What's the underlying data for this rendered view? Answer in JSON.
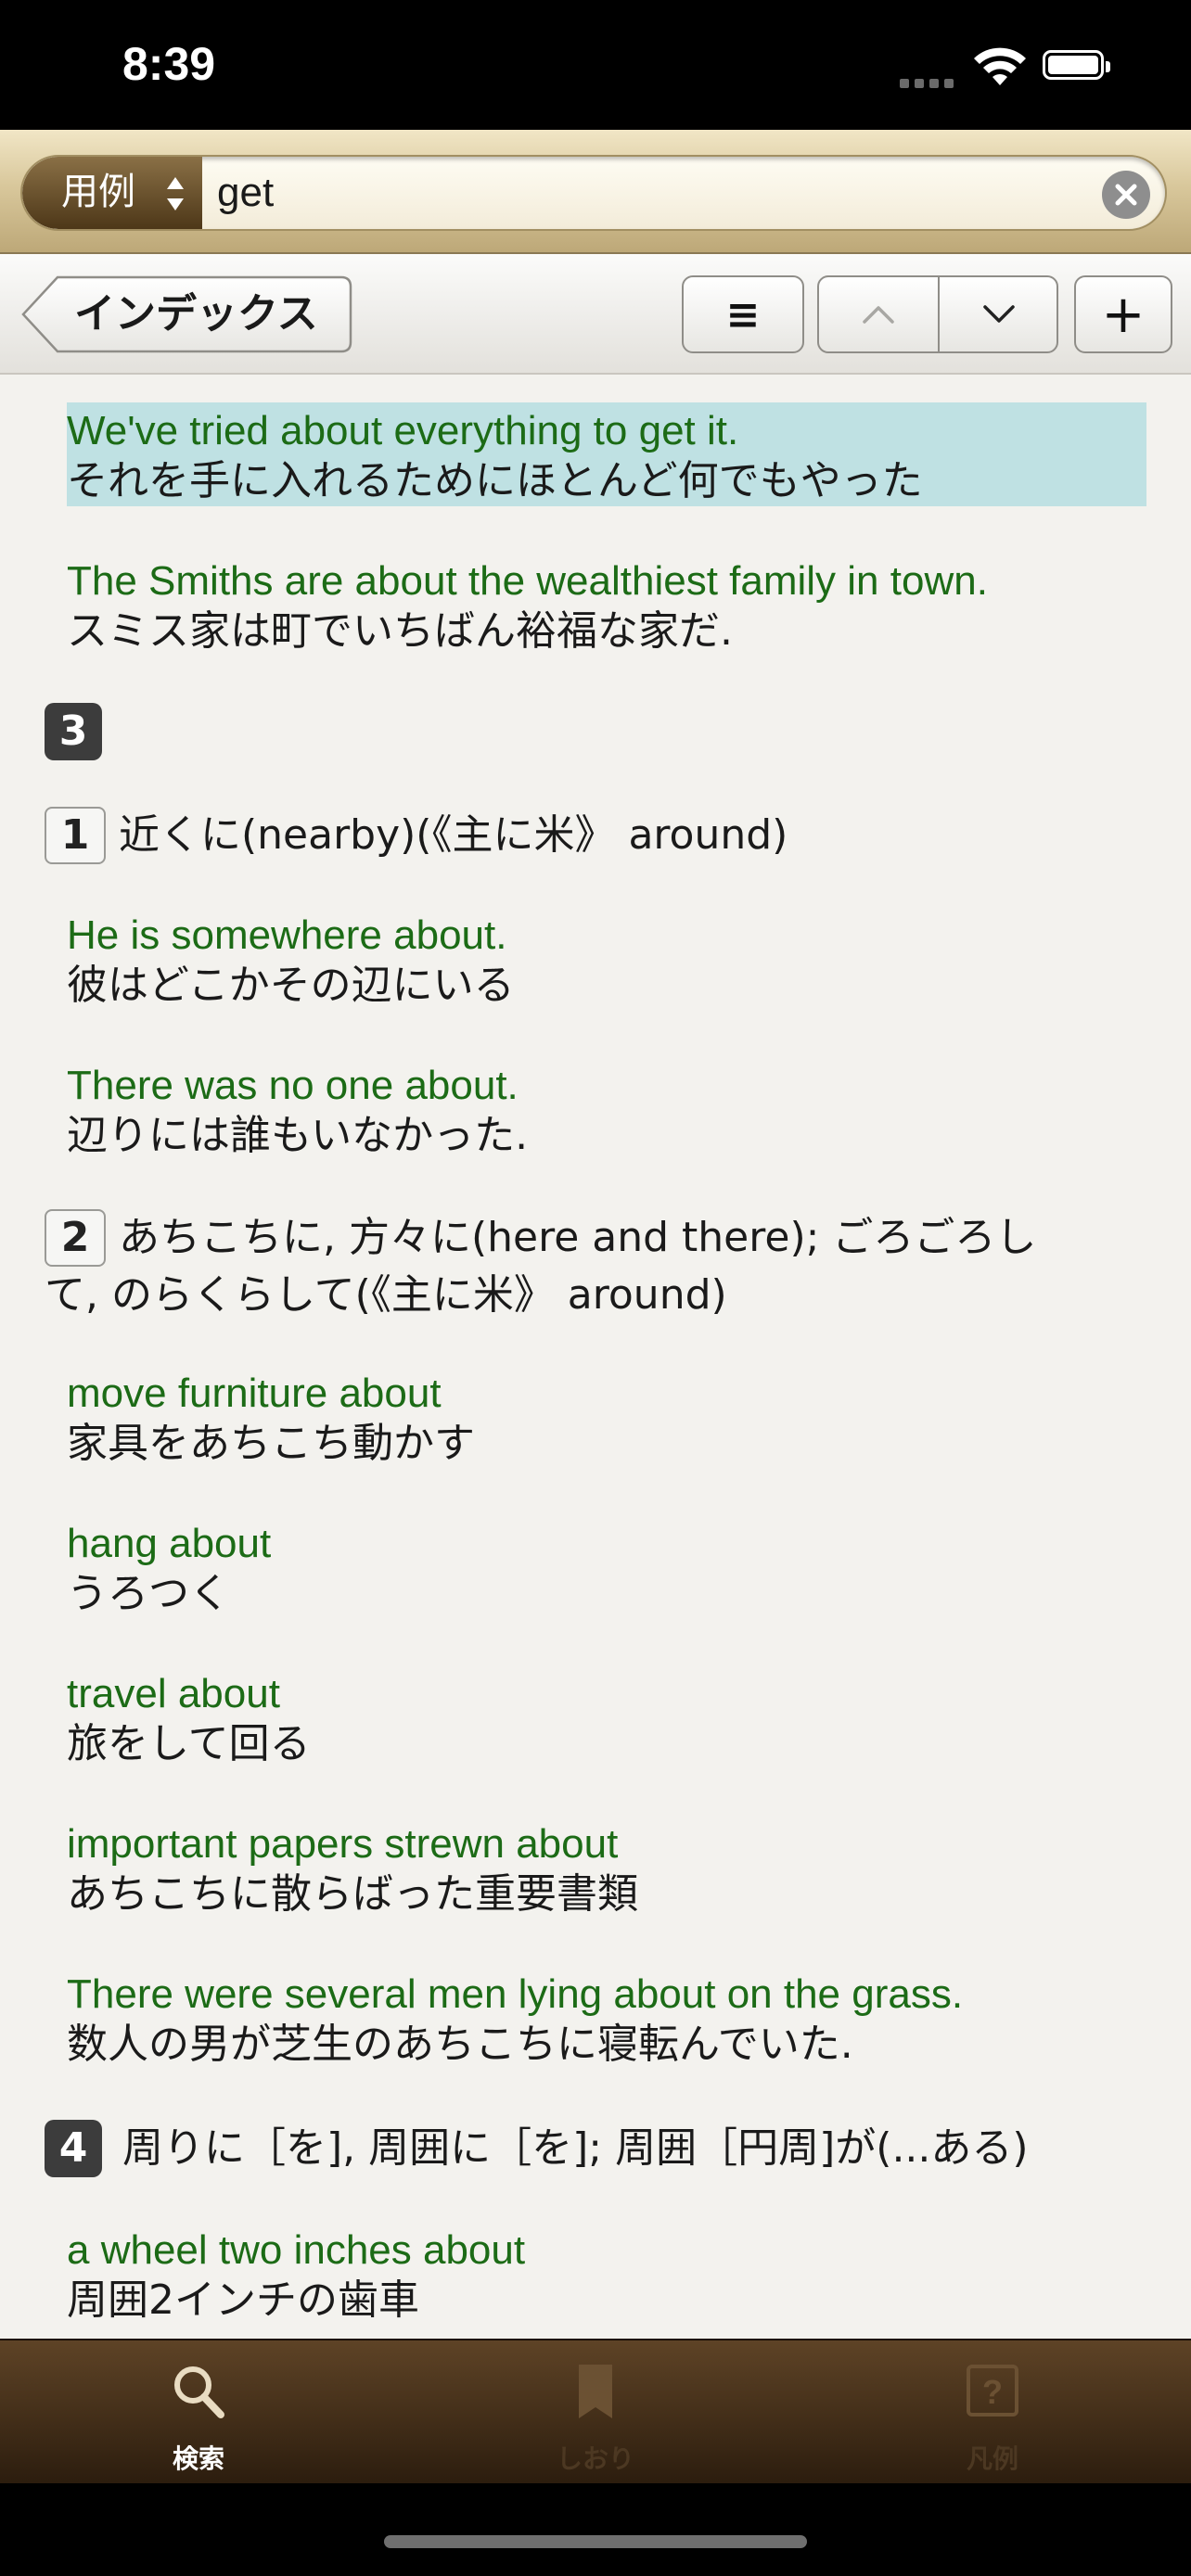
{
  "status_bar": {
    "time": "8:39"
  },
  "search": {
    "scope_label": "用例",
    "query": "get"
  },
  "nav": {
    "back_label": "インデックス",
    "list_label": "≡",
    "add_label": "+"
  },
  "entries": {
    "e1": {
      "en": "We've tried about everything to get it.",
      "ja": "それを手に入れるためにほとんど何でもやった"
    },
    "e2": {
      "en": "The Smiths are about the wealthiest family in town.",
      "ja": "スミス家は町でいちばん裕福な家だ."
    },
    "s3": {
      "num": "3"
    },
    "s3_1": {
      "num": "1",
      "text": "近くに(nearby)(《主に米》 around)"
    },
    "e3": {
      "en": "He is somewhere about.",
      "ja": "彼はどこかその辺にいる"
    },
    "e4": {
      "en": "There was no one about.",
      "ja": "辺りには誰もいなかった."
    },
    "s3_2": {
      "num": "2",
      "line1": "あちこちに, 方々に(here and there); ごろごろし",
      "line2": "て,  のらくらして(《主に米》 around)"
    },
    "e5": {
      "en": "move furniture about",
      "ja": "家具をあちこち動かす"
    },
    "e6": {
      "en": "hang about",
      "ja": "うろつく"
    },
    "e7": {
      "en": "travel about",
      "ja": "旅をして回る"
    },
    "e8": {
      "en": "important papers strewn about",
      "ja": "あちこちに散らばった重要書類"
    },
    "e9": {
      "en": "There were several men lying about on the grass.",
      "ja": "数人の男が芝生のあちこちに寝転んでいた."
    },
    "s4": {
      "num": "4",
      "text": "周りに［を], 周囲に［を]; 周囲［円周]が(...ある)"
    },
    "e10": {
      "en": "a wheel two inches about",
      "ja": "周囲2インチの歯車"
    }
  },
  "tabs": {
    "search": {
      "label": "検索",
      "icon": "magnifier-icon"
    },
    "bookmark": {
      "label": "しおり",
      "icon": "bookmark-icon"
    },
    "legend": {
      "label": "凡例",
      "icon": "question-icon"
    }
  },
  "colors": {
    "english_example": "#1c6b16",
    "highlight": "#bfe1e3",
    "tabbar": "#3e2b16"
  }
}
